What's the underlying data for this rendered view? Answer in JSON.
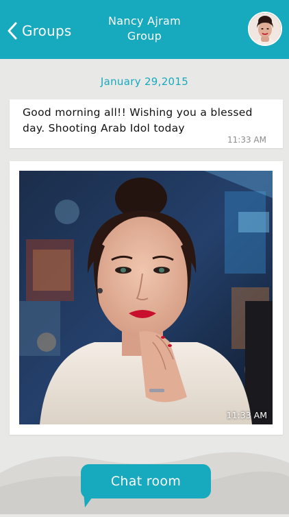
{
  "header": {
    "back_label": "Groups",
    "title": "Nancy Ajram",
    "subtitle": "Group",
    "accent_color": "#17a9bd"
  },
  "conversation": {
    "date": "January 29,2015",
    "messages": [
      {
        "type": "text",
        "text": "Good morning all!! Wishing you a blessed day. Shooting Arab Idol today",
        "time": "11:33 AM"
      },
      {
        "type": "image",
        "time": "11:33 AM"
      }
    ]
  },
  "footer": {
    "chat_room_label": "Chat room"
  }
}
